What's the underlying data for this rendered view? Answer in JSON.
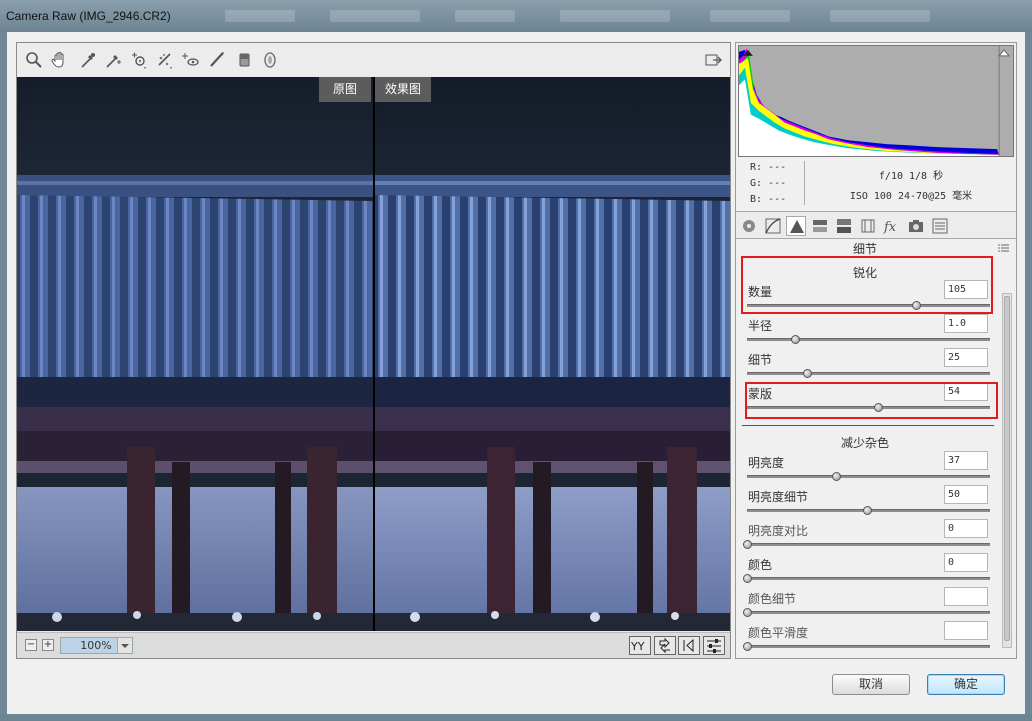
{
  "window": {
    "title": "Camera Raw (IMG_2946.CR2)"
  },
  "toolbar": {
    "tools": [
      "zoom-icon",
      "hand-icon",
      "white-balance-icon",
      "color-sampler-icon",
      "targeted-adjust-icon",
      "crop-icon",
      "spot-removal-icon",
      "red-eye-icon",
      "adjustment-brush-icon",
      "graduated-filter-icon",
      "radial-filter-icon"
    ],
    "open_prefs_icon": "preferences-icon"
  },
  "preview": {
    "before_label": "原图",
    "after_label": "效果图",
    "zoom_value": "100%",
    "zoom_minus": "−",
    "zoom_plus": "+"
  },
  "info": {
    "r": "R:  ---",
    "g": "G:  ---",
    "b": "B:  ---",
    "aperture_shutter": "f/10   1/8 秒",
    "iso_lens": "ISO 100   24-70@25 毫米"
  },
  "panel": {
    "title": "细节",
    "tabs": [
      "basic-icon",
      "tone-curve-icon",
      "detail-icon",
      "hsl-icon",
      "split-toning-icon",
      "lens-corrections-icon",
      "effects-icon",
      "camera-calibration-icon",
      "presets-icon"
    ],
    "active_tab": 2
  },
  "sharpening": {
    "title": "锐化",
    "amount": {
      "label": "数量",
      "value": "105",
      "fraction": 0.7
    },
    "radius": {
      "label": "半径",
      "value": "1.0",
      "fraction": 0.2
    },
    "detail": {
      "label": "细节",
      "value": "25",
      "fraction": 0.25
    },
    "masking": {
      "label": "蒙版",
      "value": "54",
      "fraction": 0.54
    }
  },
  "noise": {
    "title": "减少杂色",
    "luminance": {
      "label": "明亮度",
      "value": "37",
      "fraction": 0.37
    },
    "luminance_detail": {
      "label": "明亮度细节",
      "value": "50",
      "fraction": 0.5
    },
    "luminance_contrast": {
      "label": "明亮度对比",
      "value": "0",
      "fraction": 0
    },
    "color": {
      "label": "颜色",
      "value": "0",
      "fraction": 0
    },
    "color_detail": {
      "label": "颜色细节",
      "value": "",
      "fraction": 0
    },
    "color_smoothness": {
      "label": "颜色平滑度",
      "value": "",
      "fraction": 0
    }
  },
  "buttons": {
    "cancel": "取消",
    "ok": "确定"
  },
  "colors": {
    "highlight": "#e21b1b",
    "roof": "#3c5a8c",
    "sky": "#18202e"
  }
}
